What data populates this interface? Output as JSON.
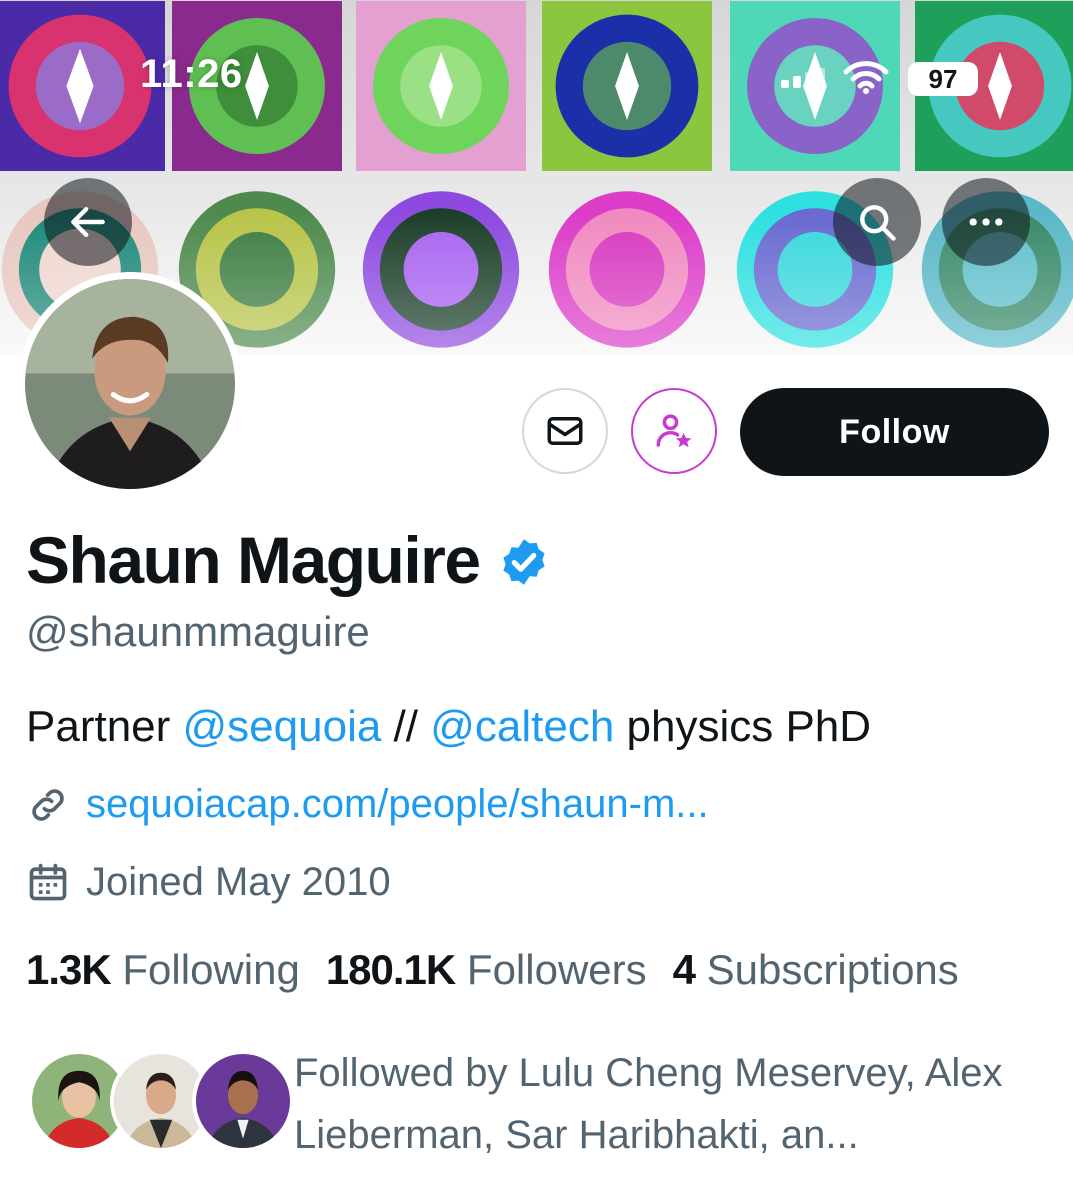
{
  "status_bar": {
    "time": "11:26",
    "battery": "97"
  },
  "icons": {
    "back": "arrow-left-icon",
    "search": "search-icon",
    "more": "more-horizontal-icon",
    "message": "envelope-icon",
    "subscribe": "person-star-icon",
    "verified": "verified-badge-icon",
    "link": "link-icon",
    "calendar": "calendar-icon"
  },
  "colors": {
    "accent": "#1d9bf0",
    "text_primary": "#0f1419",
    "text_secondary": "#536471",
    "follow_button": "#0f1419",
    "subscribe_accent": "#c93bd0"
  },
  "actions": {
    "follow_label": "Follow"
  },
  "profile": {
    "name": "Shaun Maguire",
    "handle": "@shaunmmaguire",
    "bio": {
      "prefix": "Partner ",
      "mention1": "@sequoia",
      "separator": " // ",
      "mention2": "@caltech",
      "suffix": " physics PhD"
    },
    "link": "sequoiacap.com/people/shaun-m...",
    "joined": "Joined May 2010"
  },
  "stats": {
    "following_count": "1.3K",
    "following_label": "Following",
    "followers_count": "180.1K",
    "followers_label": "Followers",
    "subscriptions_count": "4",
    "subscriptions_label": "Subscriptions"
  },
  "followed_by": {
    "text": "Followed by Lulu Cheng Meservey, Alex Lieberman, Sar Haribhakti, an..."
  }
}
